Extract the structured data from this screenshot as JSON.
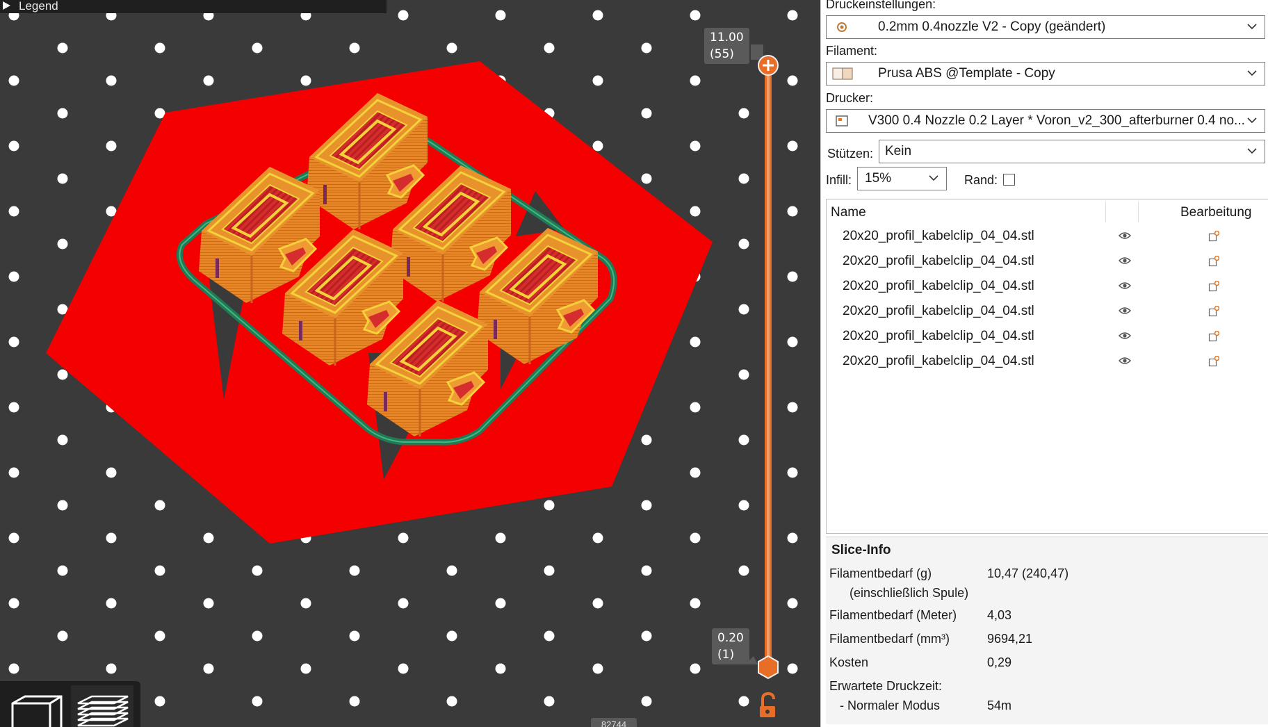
{
  "viewport": {
    "legend_label": "Legend",
    "slider": {
      "top_value": "11.00",
      "top_layer": "(55)",
      "bottom_value": "0.20",
      "bottom_layer": "(1)"
    },
    "counter": "82744",
    "icons": {
      "top_handle": "plus-icon",
      "lock": "unlock-icon",
      "view_3d": "cube-icon",
      "view_layers": "layers-icon"
    },
    "colors": {
      "bed": "#3a3a3a",
      "first_layer": "#f50000",
      "perimeter": "#ee8a28",
      "skirt": "#1f7a55",
      "slider": "#e86e28"
    }
  },
  "panel": {
    "print_settings": {
      "label": "Druckeinstellungen:",
      "value": "0.2mm 0.4nozzle V2 - Copy (geändert)"
    },
    "filament": {
      "label": "Filament:",
      "value": "Prusa ABS @Template - Copy"
    },
    "printer": {
      "label": "Drucker:",
      "value": "V300 0.4 Nozzle 0.2 Layer * Voron_v2_300_afterburner 0.4 no..."
    },
    "supports": {
      "label": "Stützen:",
      "value": "Kein"
    },
    "infill": {
      "label": "Infill:",
      "value": "15%"
    },
    "brim": {
      "label": "Rand:",
      "checked": false
    },
    "object_list": {
      "col_name": "Name",
      "col_edit": "Bearbeitung",
      "items": [
        {
          "name": "20x20_profil_kabelclip_04_04.stl"
        },
        {
          "name": "20x20_profil_kabelclip_04_04.stl"
        },
        {
          "name": "20x20_profil_kabelclip_04_04.stl"
        },
        {
          "name": "20x20_profil_kabelclip_04_04.stl"
        },
        {
          "name": "20x20_profil_kabelclip_04_04.stl"
        },
        {
          "name": "20x20_profil_kabelclip_04_04.stl"
        }
      ]
    },
    "slice_info": {
      "title": "Slice-Info",
      "filament_g_label": "Filamentbedarf (g)",
      "filament_g_sub": "(einschließlich Spule)",
      "filament_g_value": "10,47 (240,47)",
      "filament_m_label": "Filamentbedarf (Meter)",
      "filament_m_value": "4,03",
      "filament_mm3_label": "Filamentbedarf (mm³)",
      "filament_mm3_value": "9694,21",
      "cost_label": "Kosten",
      "cost_value": "0,29",
      "time_label": "Erwartete Druckzeit:",
      "mode_label": "- Normaler Modus",
      "mode_value": "54m"
    }
  }
}
